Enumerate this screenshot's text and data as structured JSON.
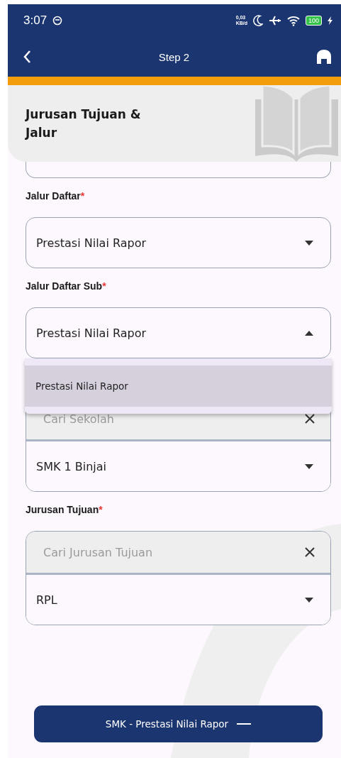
{
  "status_bar": {
    "time": "3:07",
    "net_speed": "0,03",
    "net_unit": "KB/d",
    "battery": "100"
  },
  "app_bar": {
    "title": "Step 2"
  },
  "header": {
    "title": "Jurusan Tujuan &\nJalur"
  },
  "fields": [
    {
      "kind": "cut"
    },
    {
      "kind": "select",
      "label": "Jalur Daftar",
      "required_mark": "*",
      "value": "Prestasi Nilai Rapor",
      "expanded": false
    },
    {
      "kind": "select",
      "label": "Jalur Daftar Sub",
      "required_mark": "*",
      "value": "Prestasi Nilai Rapor",
      "expanded": true,
      "menu": [
        {
          "label": "Prestasi Nilai Rapor",
          "selected": true
        }
      ]
    },
    {
      "kind": "search_select",
      "search_placeholder": "Cari Sekolah",
      "value": "SMK 1 Binjai",
      "expanded": false
    },
    {
      "kind": "search_select",
      "label": "Jurusan Tujuan",
      "required_mark": "*",
      "search_placeholder": "Cari Jurusan Tujuan",
      "value": "RPL",
      "expanded": false
    }
  ],
  "submit_button": {
    "label": "SMK - Prestasi Nilai Rapor"
  }
}
